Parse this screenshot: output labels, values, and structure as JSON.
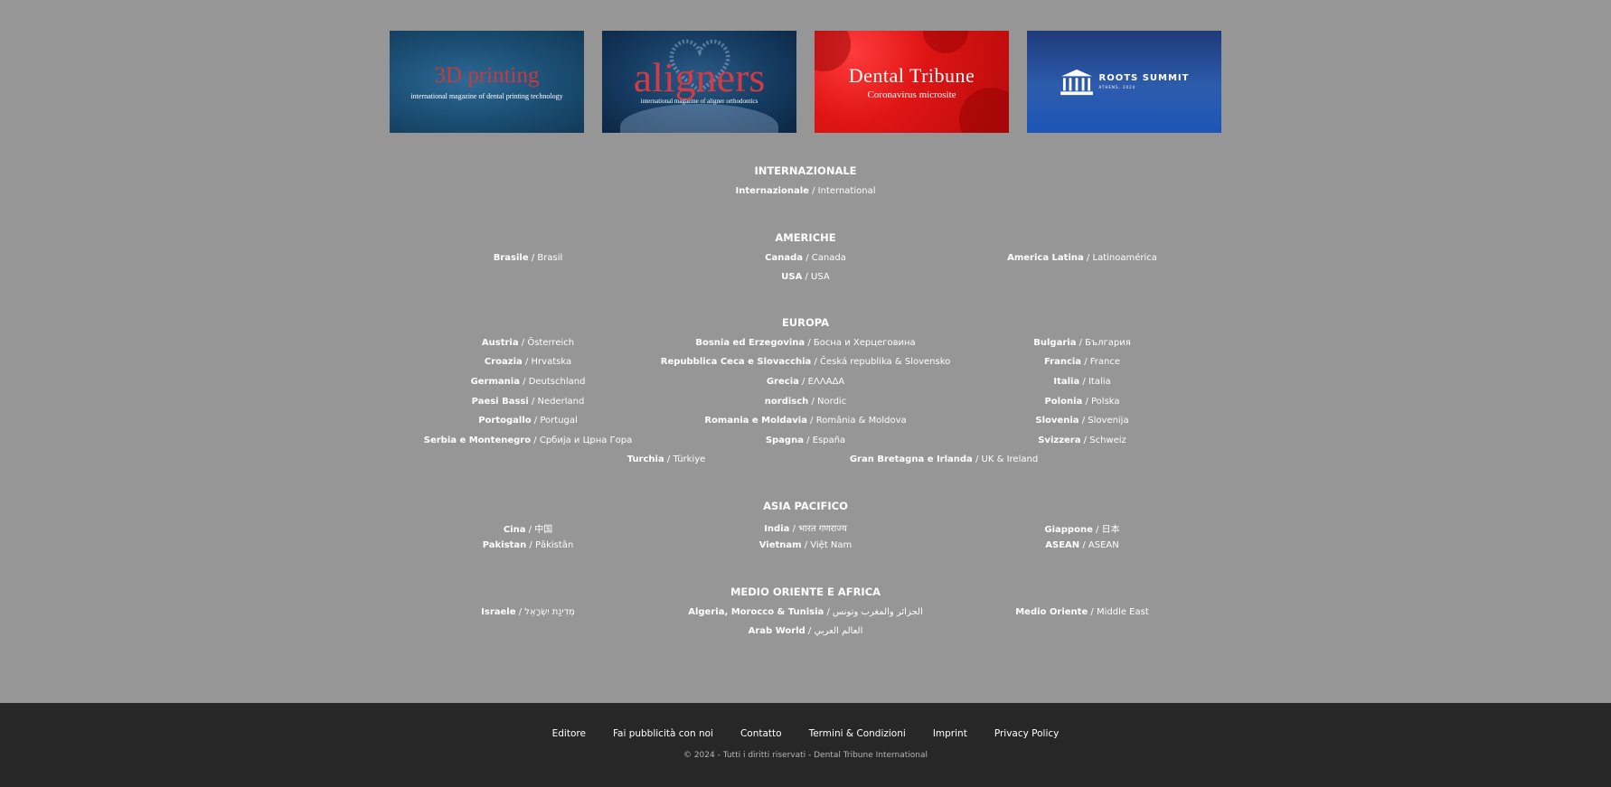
{
  "banners": [
    {
      "title": "3D printing",
      "subtitle": "international magazine of dental printing technology"
    },
    {
      "title": "aligners",
      "subtitle": "international magazine of aligner orthodontics"
    },
    {
      "title": "Dental Tribune",
      "subtitle": "Coronavirus microsite"
    },
    {
      "title": "ROOTS SUMMIT",
      "subtitle": "ATHENS, 2024"
    }
  ],
  "sections": {
    "internazionale": {
      "title": "INTERNAZIONALE",
      "items": [
        {
          "name": "Internazionale",
          "native": "International"
        }
      ]
    },
    "americhe": {
      "title": "AMERICHE",
      "items": [
        {
          "name": "Brasile",
          "native": "Brasil"
        },
        {
          "name": "Canada",
          "native": "Canada"
        },
        {
          "name": "America Latina",
          "native": "Latinoamérica"
        },
        {
          "name": "USA",
          "native": "USA"
        }
      ]
    },
    "europa": {
      "title": "EUROPA",
      "items": [
        {
          "name": "Austria",
          "native": "Österreich"
        },
        {
          "name": "Bosnia ed Erzegovina",
          "native": "Босна и Херцеговина"
        },
        {
          "name": "Bulgaria",
          "native": "България"
        },
        {
          "name": "Croazia",
          "native": "Hrvatska"
        },
        {
          "name": "Repubblica Ceca e Slovacchia",
          "native": "Česká republika & Slovensko"
        },
        {
          "name": "Francia",
          "native": "France"
        },
        {
          "name": "Germania",
          "native": "Deutschland"
        },
        {
          "name": "Grecia",
          "native": "ΕΛΛΑΔΑ"
        },
        {
          "name": "Italia",
          "native": "Italia"
        },
        {
          "name": "Paesi Bassi",
          "native": "Nederland"
        },
        {
          "name": "nordisch",
          "native": "Nordic"
        },
        {
          "name": "Polonia",
          "native": "Polska"
        },
        {
          "name": "Portogallo",
          "native": "Portugal"
        },
        {
          "name": "Romania e Moldavia",
          "native": "România & Moldova"
        },
        {
          "name": "Slovenia",
          "native": "Slovenija"
        },
        {
          "name": "Serbia e Montenegro",
          "native": "Србија и Црна Гора"
        },
        {
          "name": "Spagna",
          "native": "España"
        },
        {
          "name": "Svizzera",
          "native": "Schweiz"
        },
        {
          "name": "Turchia",
          "native": "Türkiye"
        },
        {
          "name": "Gran Bretagna e Irlanda",
          "native": "UK & Ireland"
        }
      ]
    },
    "asia": {
      "title": "ASIA PACIFICO",
      "items": [
        {
          "name": "Cina",
          "native": "中国"
        },
        {
          "name": "India",
          "native": "भारत गणराज्य"
        },
        {
          "name": "Giappone",
          "native": "日本"
        },
        {
          "name": "Pakistan",
          "native": "Pākistān"
        },
        {
          "name": "Vietnam",
          "native": "Việt Nam"
        },
        {
          "name": "ASEAN",
          "native": "ASEAN"
        }
      ]
    },
    "medio": {
      "title": "MEDIO ORIENTE E AFRICA",
      "items": [
        {
          "name": "Israele",
          "native": "מְדִינַת יִשְׂרָאֵל"
        },
        {
          "name": "Algeria, Morocco & Tunisia",
          "native": "الجزائر والمغرب وتونس"
        },
        {
          "name": "Medio Oriente",
          "native": "Middle East"
        },
        {
          "name": "Arab World",
          "native": "العالم العربي"
        }
      ]
    }
  },
  "separator": " / ",
  "footer": {
    "links": [
      "Editore",
      "Fai pubblicità con noi",
      "Contatto",
      "Termini & Condizioni",
      "Imprint",
      "Privacy Policy"
    ],
    "copyright": "© 2024 - Tutti i diritti riservati - Dental Tribune International"
  }
}
